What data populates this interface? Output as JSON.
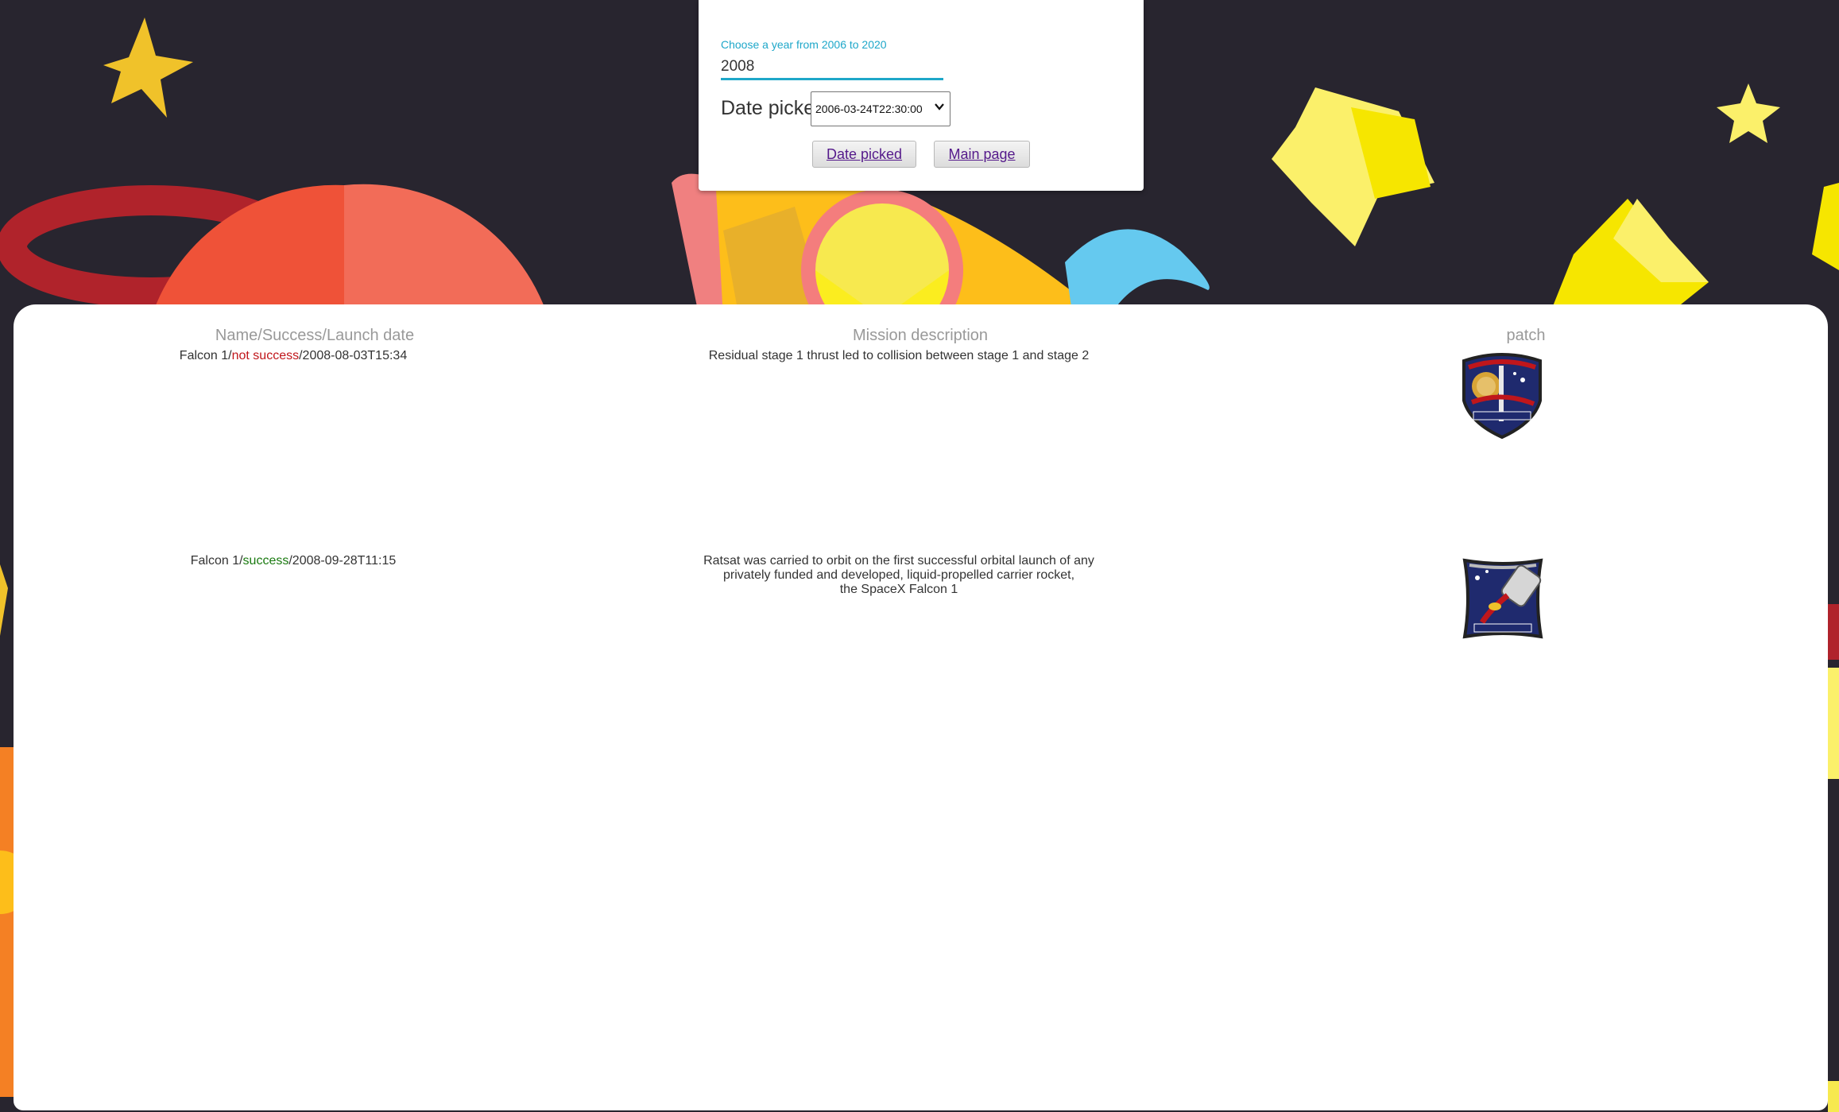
{
  "form": {
    "year_label": "Choose a year from 2006 to 2020",
    "year_value": "2008",
    "date_picker_label": "Date picker",
    "date_picker_value": "2006-03-24T22:30:00",
    "date_picked_button": "Date picked",
    "main_page_button": "Main page"
  },
  "table": {
    "headers": {
      "name": "Name/Success/Launch date",
      "description": "Mission description",
      "patch": "patch"
    },
    "rows": [
      {
        "name": "Falcon 1",
        "separator": "/",
        "status": "not success",
        "launch_date": "2008-08-03T15:34",
        "description": [
          "Residual stage 1 thrust led to collision between stage 1 and stage 2"
        ],
        "patch_icon": "falcon-mission-patch-icon"
      },
      {
        "name": "Falcon 1",
        "separator": "/",
        "status": "success",
        "launch_date": "2008-09-28T11:15",
        "description": [
          "Ratsat was carried to orbit on the first successful orbital launch of any",
          "privately funded and developed, liquid-propelled carrier rocket,",
          "the SpaceX Falcon 1"
        ],
        "patch_icon": "ratsat-mission-patch-icon"
      }
    ]
  },
  "colors": {
    "background": "#28252f",
    "accent": "#1ea7c9",
    "status_bad": "#c0161b",
    "status_good": "#1a7a10",
    "link": "#551a8b"
  }
}
